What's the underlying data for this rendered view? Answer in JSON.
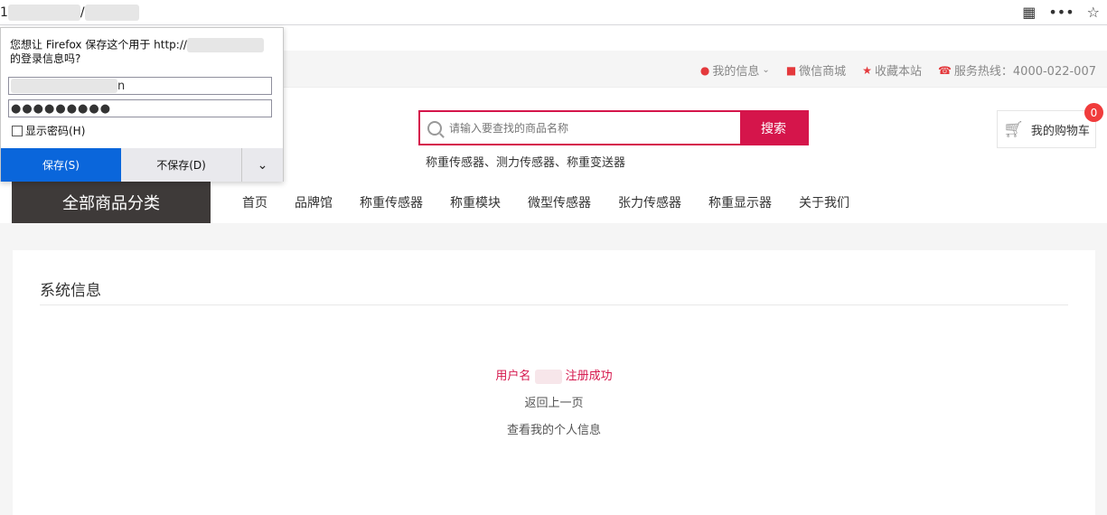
{
  "browser": {
    "url_prefix": "1",
    "url_sep": "/",
    "qr_icon": "qr-icon",
    "more_label": "•••",
    "star_label": "☆"
  },
  "topbar": {
    "my_info": "我的信息",
    "wechat_mall": "微信商城",
    "bookmark": "收藏本站",
    "hotline": "服务热线：4000-022-007"
  },
  "search": {
    "placeholder": "请输入要查找的商品名称",
    "button_label": "搜索",
    "hot_words": "称重传感器、测力传感器、称重变送器"
  },
  "cart": {
    "label": "我的购物车",
    "count": "0"
  },
  "nav": {
    "category_label": "全部商品分类",
    "items": [
      "首页",
      "品牌馆",
      "称重传感器",
      "称重模块",
      "微型传感器",
      "张力传感器",
      "称重显示器",
      "关于我们"
    ]
  },
  "content": {
    "title": "系统信息",
    "success_prefix": "用户名",
    "success_suffix": "注册成功",
    "back_link": "返回上一页",
    "profile_link": "查看我的个人信息"
  },
  "popup": {
    "message_line1": "您想让 Firefox 保存这个用于 http://",
    "message_line2": "的登录信息吗?",
    "username_tail": "n",
    "password_mask": "●●●●●●●●●",
    "show_password": "显示密码(H)",
    "save_label": "保存(S)",
    "nosave_label": "不保存(D)",
    "dropdown_label": "⌄"
  },
  "colors": {
    "accent": "#d5154b",
    "nav_dark": "#3e3a39",
    "firefox_blue": "#0a66db"
  }
}
